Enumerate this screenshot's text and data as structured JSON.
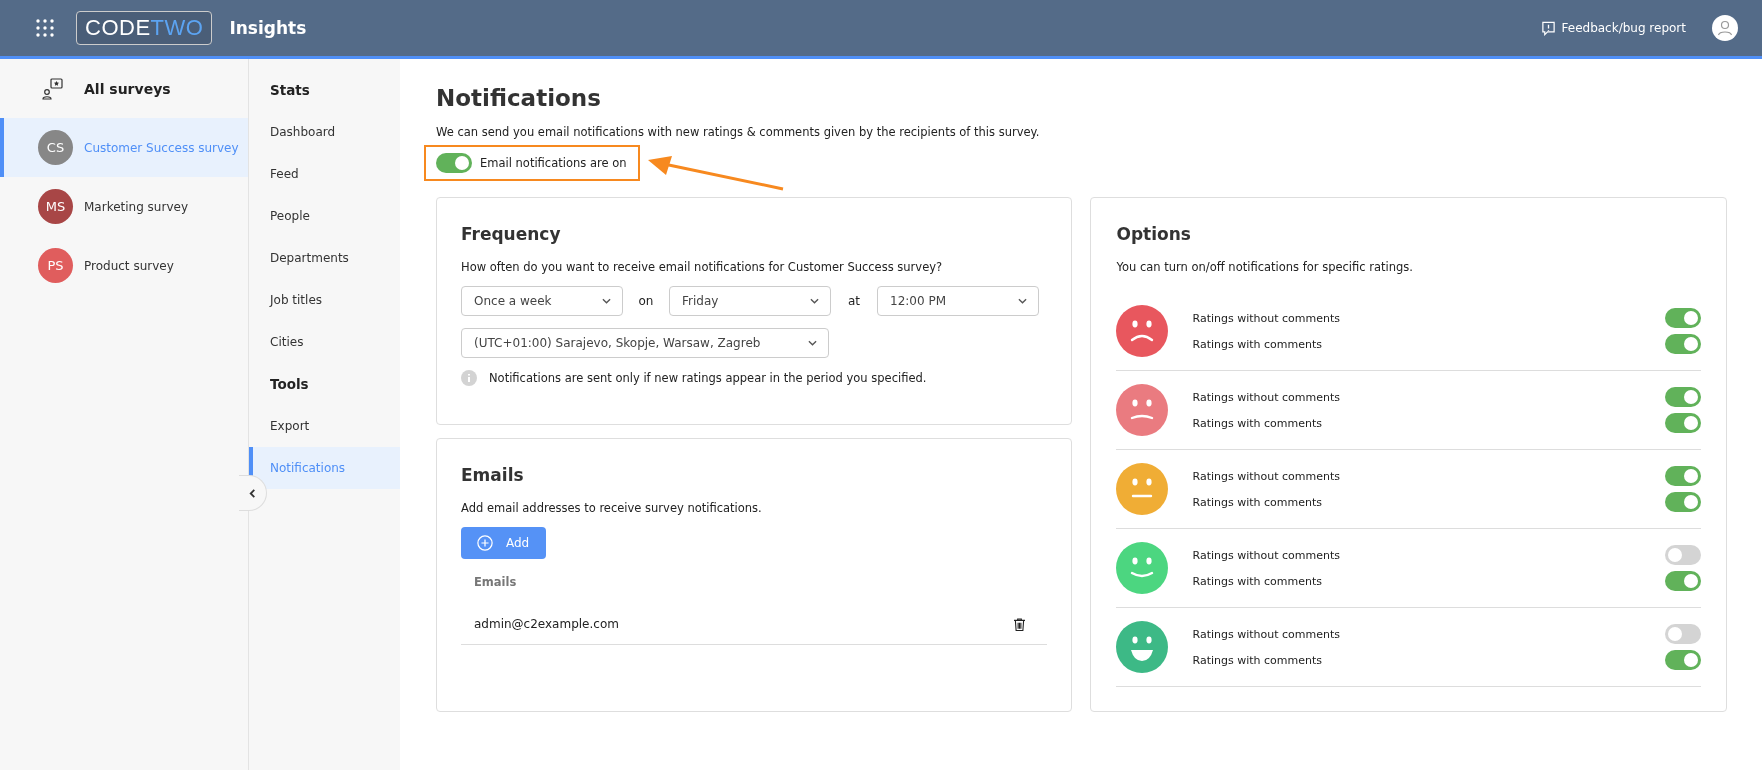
{
  "header": {
    "logo": [
      "CODE",
      "TWO"
    ],
    "app_title": "Insights",
    "feedback": "Feedback/bug report"
  },
  "surveys_sidebar": {
    "title": "All surveys",
    "items": [
      {
        "initials": "CS",
        "name": "Customer Success survey",
        "color": "#878787",
        "selected": true
      },
      {
        "initials": "MS",
        "name": "Marketing survey",
        "color": "#a84646",
        "selected": false
      },
      {
        "initials": "PS",
        "name": "Product survey",
        "color": "#e05d5d",
        "selected": false
      }
    ]
  },
  "nav": {
    "sections": [
      {
        "heading": "Stats",
        "items": [
          {
            "label": "Dashboard",
            "selected": false
          },
          {
            "label": "Feed",
            "selected": false
          },
          {
            "label": "People",
            "selected": false
          },
          {
            "label": "Departments",
            "selected": false
          },
          {
            "label": "Job titles",
            "selected": false
          },
          {
            "label": "Cities",
            "selected": false
          }
        ]
      },
      {
        "heading": "Tools",
        "items": [
          {
            "label": "Export",
            "selected": false
          },
          {
            "label": "Notifications",
            "selected": true
          }
        ]
      }
    ]
  },
  "page": {
    "title": "Notifications",
    "description": "We can send you email notifications with new ratings & comments given by the recipients of this survey.",
    "master_toggle": {
      "label": "Email notifications are on",
      "on": true
    }
  },
  "frequency": {
    "title": "Frequency",
    "question": "How often do you want to receive email notifications for Customer Success survey?",
    "interval": "Once a week",
    "on_label": "on",
    "day": "Friday",
    "at_label": "at",
    "time": "12:00 PM",
    "timezone": "(UTC+01:00) Sarajevo, Skopje, Warsaw, Zagreb",
    "info": "Notifications are sent only if new ratings appear in the period you specified."
  },
  "emails": {
    "title": "Emails",
    "description": "Add email addresses to receive survey notifications.",
    "add_button": "Add",
    "column": "Emails",
    "rows": [
      {
        "email": "admin@c2example.com"
      }
    ]
  },
  "options": {
    "title": "Options",
    "description": "You can turn on/off notifications for specific ratings.",
    "ratings": [
      {
        "kind": "sad",
        "color": "#e8575e",
        "toggles": [
          {
            "label": "Ratings without comments",
            "on": true
          },
          {
            "label": "Ratings with comments",
            "on": true
          }
        ]
      },
      {
        "kind": "unhappy",
        "color": "#ea7b80",
        "toggles": [
          {
            "label": "Ratings without comments",
            "on": true
          },
          {
            "label": "Ratings with comments",
            "on": true
          }
        ]
      },
      {
        "kind": "neutral",
        "color": "#f0ad35",
        "toggles": [
          {
            "label": "Ratings without comments",
            "on": true
          },
          {
            "label": "Ratings with comments",
            "on": true
          }
        ]
      },
      {
        "kind": "smile",
        "color": "#4cd680",
        "toggles": [
          {
            "label": "Ratings without comments",
            "on": false
          },
          {
            "label": "Ratings with comments",
            "on": true
          }
        ]
      },
      {
        "kind": "grin",
        "color": "#3db986",
        "toggles": [
          {
            "label": "Ratings without comments",
            "on": false
          },
          {
            "label": "Ratings with comments",
            "on": true
          }
        ]
      }
    ]
  }
}
